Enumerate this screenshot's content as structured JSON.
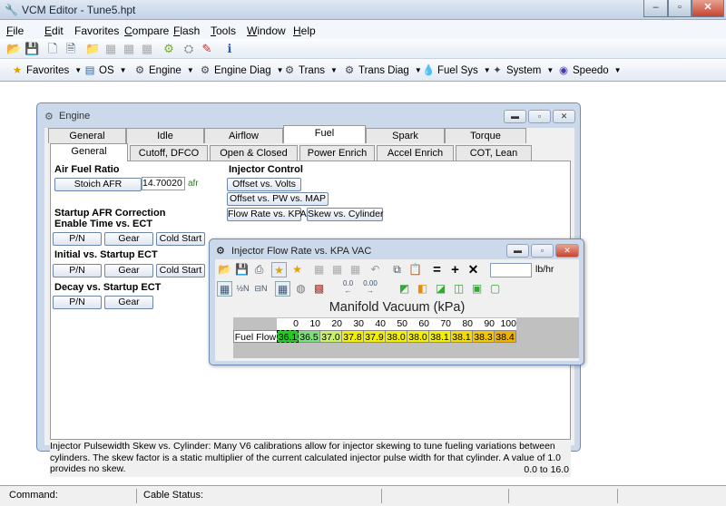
{
  "app": {
    "icon": "wrench-icon",
    "title": "VCM Editor - Tune5.hpt"
  },
  "menus": [
    {
      "label": "File",
      "accel": "F",
      "rest": "ile"
    },
    {
      "label": "Edit",
      "accel": "E",
      "rest": "dit"
    },
    {
      "label": "Favorites",
      "accel": "",
      "rest": "Favorites"
    },
    {
      "label": "Compare",
      "accel": "C",
      "rest": "ompare"
    },
    {
      "label": "Flash",
      "accel": "F",
      "rest": "lash"
    },
    {
      "label": "Tools",
      "accel": "T",
      "rest": "ools"
    },
    {
      "label": "Window",
      "accel": "W",
      "rest": "indow"
    },
    {
      "label": "Help",
      "accel": "H",
      "rest": "elp"
    }
  ],
  "toolbar_nav": [
    {
      "label": "Favorites",
      "icon": "star-icon"
    },
    {
      "label": "OS",
      "icon": "os-icon"
    },
    {
      "label": "Engine",
      "icon": "engine-icon"
    },
    {
      "label": "Engine Diag",
      "icon": "engine-diag-icon"
    },
    {
      "label": "Trans",
      "icon": "trans-icon"
    },
    {
      "label": "Trans Diag",
      "icon": "trans-diag-icon"
    },
    {
      "label": "Fuel Sys",
      "icon": "fuel-drop-icon"
    },
    {
      "label": "System",
      "icon": "system-icon"
    },
    {
      "label": "Speedo",
      "icon": "speedo-icon"
    }
  ],
  "engine_window": {
    "title": "Engine",
    "tabs_row1": [
      "General",
      "Idle",
      "Airflow",
      "Fuel",
      "Spark",
      "Torque Management"
    ],
    "active_tab1": "Fuel",
    "tabs_row2": [
      "General",
      "Cutoff, DFCO",
      "Open & Closed Loop",
      "Power Enrich",
      "Accel Enrich",
      "COT, Lean Cruise"
    ],
    "active_tab2": "General",
    "afr": {
      "heading": "Air Fuel Ratio",
      "button": "Stoich AFR",
      "value": "14.70020",
      "unit": "afr"
    },
    "startup": {
      "heading": "Startup AFR Correction",
      "sub1": "Enable Time vs. ECT",
      "sub2": "Initial vs. Startup ECT",
      "sub3": "Decay vs. Startup ECT",
      "btn_pn": "P/N",
      "btn_gear": "Gear",
      "btn_cold": "Cold Start"
    },
    "injector": {
      "heading": "Injector Control",
      "offset_volts": "Offset vs. Volts",
      "offset_pw": "Offset vs. PW vs. MAP",
      "flow_rate": "Flow Rate vs. KPA",
      "skew": "Skew vs. Cylinder"
    },
    "description": "Injector Pulsewidth Skew vs. Cylinder: Many V6 calibrations allow for injector skewing to tune fueling variations between cylinders. The skew factor is a static multiplier of the current calculated injector pulse width for that cylinder. A value of 1.0 provides no skew.",
    "range": "0.0 to 16.0"
  },
  "injector_window": {
    "title": "Injector Flow Rate vs. KPA VAC",
    "unit": "lb/hr",
    "axis_title": "Manifold Vacuum (kPa)",
    "row_label": "Fuel Flow",
    "columns": [
      "0",
      "10",
      "20",
      "30",
      "40",
      "50",
      "60",
      "70",
      "80",
      "90",
      "100"
    ],
    "values": [
      "36.1",
      "36.5",
      "37.0",
      "37.8",
      "37.9",
      "38.0",
      "38.0",
      "38.1",
      "38.1",
      "38.3",
      "38.4"
    ],
    "colors": [
      "#22cc22",
      "#7be07b",
      "#c8f06a",
      "#f4f000",
      "#f4f000",
      "#f4f000",
      "#f4f000",
      "#f4f000",
      "#f4dc00",
      "#f4c800",
      "#f0b000"
    ]
  },
  "status": {
    "command": "Command:",
    "cable": "Cable Status:"
  }
}
